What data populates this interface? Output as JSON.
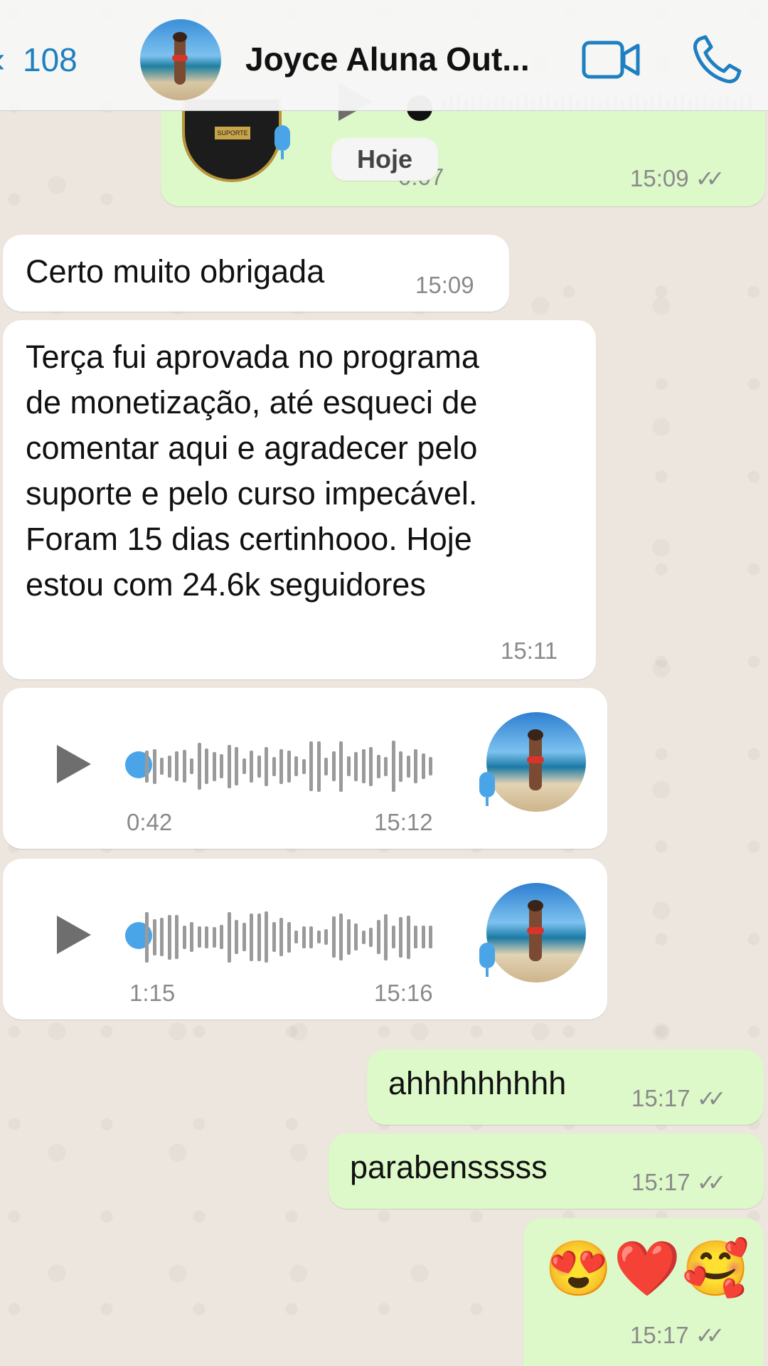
{
  "header": {
    "back_count": "108",
    "contact_name": "Joyce Aluna Out..."
  },
  "date_divider": "Hoje",
  "top_audio": {
    "duration": "0:07",
    "time": "15:09"
  },
  "messages": [
    {
      "text": "Certo muito obrigada",
      "time": "15:09"
    },
    {
      "lines": [
        "Terça fui aprovada no programa",
        "de monetização, até esqueci de",
        "comentar aqui e agradecer pelo",
        "suporte e pelo curso impecável.",
        "Foram 15 dias certinhooo. Hoje",
        "estou com 24.6k seguidores"
      ],
      "time": "15:11"
    },
    {
      "audio_duration": "0:42",
      "time": "15:12"
    },
    {
      "audio_duration": "1:15",
      "time": "15:16"
    },
    {
      "text": "ahhhhhhhhh",
      "time": "15:17"
    },
    {
      "text": "parabensssss",
      "time": "15:17"
    },
    {
      "emojis": "😍❤️🥰",
      "time": "15:17"
    }
  ],
  "ticks": "✓✓",
  "colors": {
    "accent": "#1E7FC1",
    "outgoing_bubble": "#DDF8C9",
    "incoming_bubble": "#FFFFFF",
    "audio_dot": "#4AA5E8"
  },
  "icons": {
    "video": "video-call-icon",
    "phone": "phone-call-icon",
    "back": "chevron-left-icon"
  }
}
